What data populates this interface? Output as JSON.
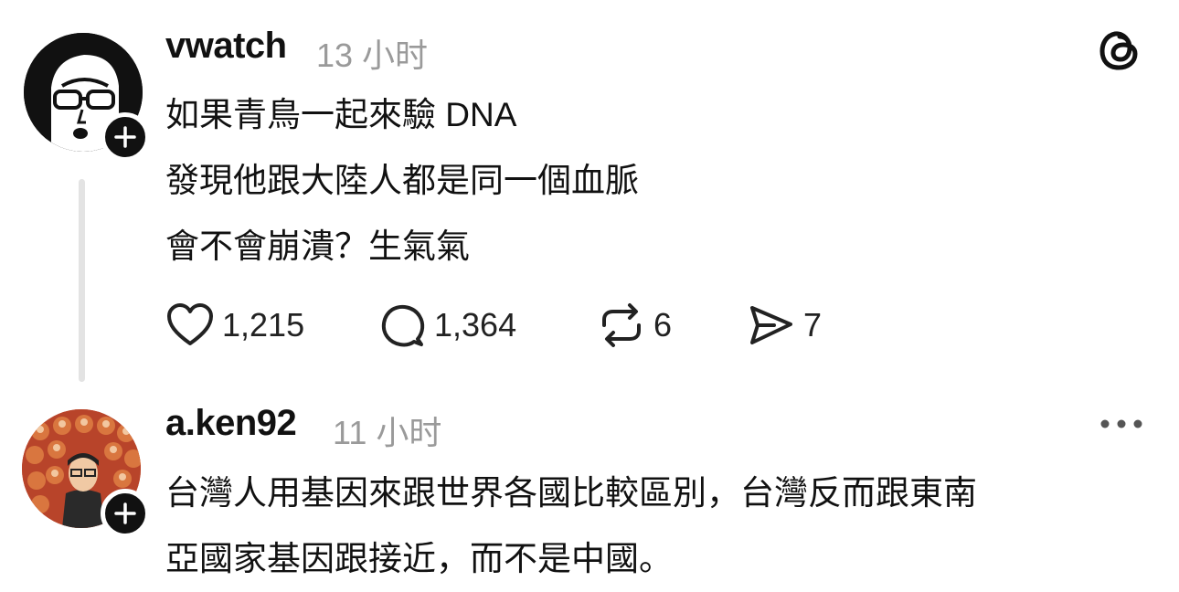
{
  "post1": {
    "username": "vwatch",
    "time": "13 小时",
    "lines": [
      "如果青鳥一起來驗 DNA",
      "發現他跟大陸人都是同一個血脈",
      "會不會崩潰？生氣氣"
    ],
    "likes": "1,215",
    "replies": "1,364",
    "reposts": "6",
    "shares": "7"
  },
  "post2": {
    "username": "a.ken92",
    "time": "11 小时",
    "lines": [
      "台灣人用基因來跟世界各國比較區別，台灣反而跟東南",
      "亞國家基因跟接近，而不是中國。"
    ]
  },
  "icons": {
    "logo": "threads-logo-icon",
    "like": "heart-icon",
    "reply": "comment-icon",
    "repost": "repost-icon",
    "share": "send-icon",
    "more": "more-horizontal-icon",
    "follow": "plus-icon"
  }
}
